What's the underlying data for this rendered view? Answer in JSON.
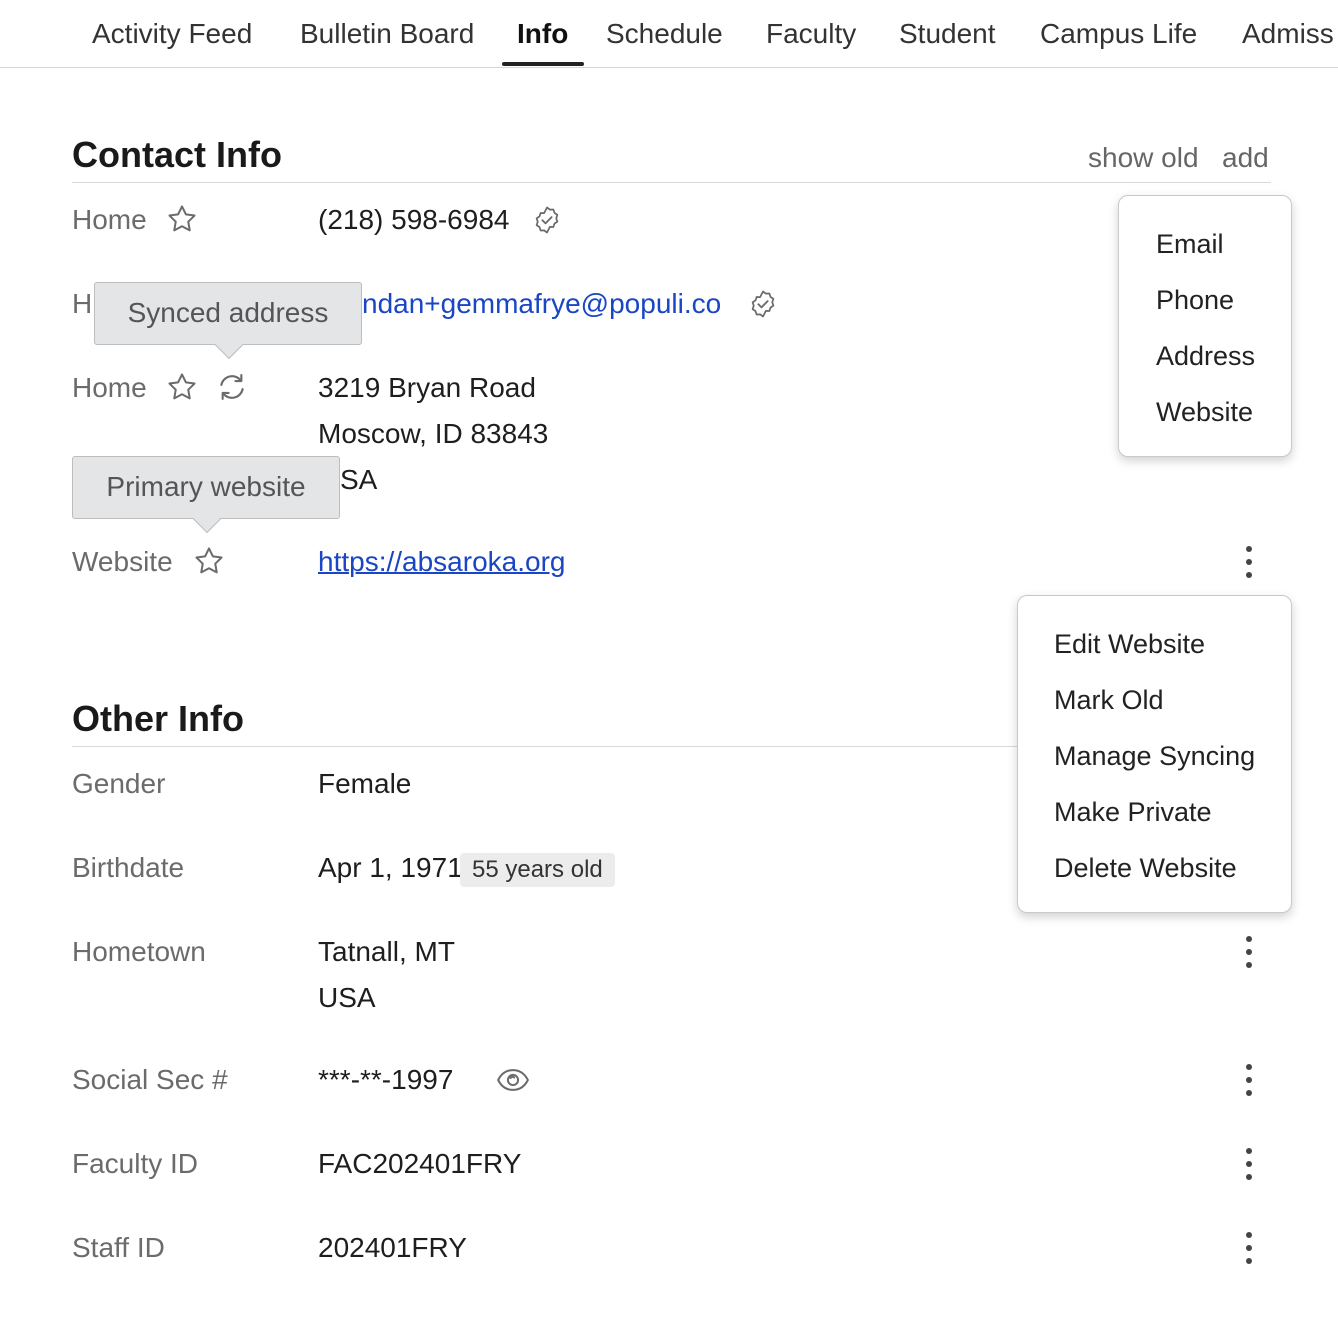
{
  "tabs": [
    {
      "label": "Activity Feed"
    },
    {
      "label": "Bulletin Board"
    },
    {
      "label": "Info"
    },
    {
      "label": "Schedule"
    },
    {
      "label": "Faculty"
    },
    {
      "label": "Student"
    },
    {
      "label": "Campus Life"
    },
    {
      "label": "Admiss"
    }
  ],
  "active_tab": "Info",
  "contact": {
    "title": "Contact Info",
    "show_old": "show old",
    "add": "add",
    "phone": {
      "label": "Home",
      "value": "(218) 598-6984"
    },
    "email": {
      "label": "H",
      "value": "ndan+gemmafrye@populi.co"
    },
    "address": {
      "label": "Home",
      "line1": "3219 Bryan Road",
      "line2": "Moscow, ID 83843",
      "line3": "SA"
    },
    "website": {
      "label": "Website",
      "value": "https://absaroka.org"
    }
  },
  "tooltips": {
    "synced": "Synced address",
    "primary": "Primary website"
  },
  "add_menu": [
    "Email",
    "Phone",
    "Address",
    "Website"
  ],
  "website_menu": [
    "Edit Website",
    "Mark Old",
    "Manage Syncing",
    "Make Private",
    "Delete Website"
  ],
  "other": {
    "title": "Other Info",
    "gender": {
      "label": "Gender",
      "value": "Female"
    },
    "birthdate": {
      "label": "Birthdate",
      "value": "Apr 1, 1971",
      "age": "55 years old"
    },
    "hometown": {
      "label": "Hometown",
      "line1": "Tatnall, MT",
      "line2": "USA"
    },
    "ssn": {
      "label": "Social Sec #",
      "value": "***-**-1997"
    },
    "faculty_id": {
      "label": "Faculty ID",
      "value": "FAC202401FRY"
    },
    "staff_id": {
      "label": "Staff ID",
      "value": "202401FRY"
    }
  },
  "colors": {
    "link": "#1a46c4",
    "label": "#6b6b6b",
    "tooltip_bg": "#e4e5e6"
  },
  "icons": {
    "star": "star-icon",
    "verified": "verified-badge-icon",
    "sync": "sync-icon",
    "eye": "eye-icon",
    "kebab": "kebab-menu-icon"
  }
}
